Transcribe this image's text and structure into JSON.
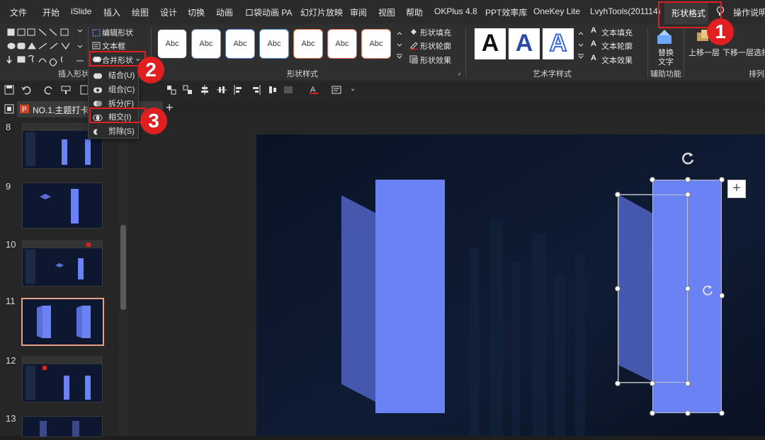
{
  "menubar": {
    "items": [
      "文件",
      "开始",
      "iSlide",
      "插入",
      "绘图",
      "设计",
      "切换",
      "动画",
      "口袋动画 PA",
      "幻灯片放映",
      "审阅",
      "视图",
      "帮助",
      "OKPlus 4.8",
      "PPT效率库",
      "OneKey Lite",
      "LvyhTools(201114)"
    ],
    "active_tab": "形状格式",
    "search_label": "操作说明"
  },
  "ribbon": {
    "insert_shapes_label": "插入形状",
    "edit_shape": "编辑形状",
    "text_box": "文本框",
    "merge_shapes": "合并形状",
    "shape_styles_label": "形状样式",
    "style_sample": "Abc",
    "shape_fill": "形状填充",
    "shape_outline": "形状轮廓",
    "shape_effects": "形状效果",
    "wordart_label": "艺术字样式",
    "wordart_sample": "A",
    "text_fill": "文本填充",
    "text_outline": "文本轮廓",
    "text_effects": "文本效果",
    "replace_text_line1": "替换",
    "replace_text_line2": "文字",
    "aux_label": "辅助功能",
    "bring_forward": "上移一层",
    "send_backward": "下移一层",
    "select": "选择",
    "arrange_label": "排列"
  },
  "merge_menu": {
    "items": [
      "结合(U)",
      "组合(C)",
      "拆分(F)",
      "相交(I)",
      "剪除(S)"
    ]
  },
  "doc_tab": {
    "title": "NO.1.主题打卡-"
  },
  "callouts": [
    "1",
    "2",
    "3"
  ],
  "slides": {
    "numbers": [
      "8",
      "9",
      "10",
      "11",
      "12",
      "13"
    ],
    "active": "11"
  },
  "colors": {
    "accent_red": "#e02020",
    "shape_blue": "#6b82f5",
    "slide_bg": "#0b1426",
    "active_thumb_border": "#e8a088"
  }
}
